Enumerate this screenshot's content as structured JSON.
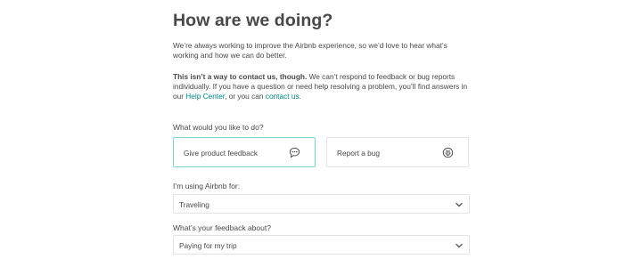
{
  "page": {
    "title": "How are we doing?",
    "intro": "We’re always working to improve the Airbnb experience, so we’d love to hear what’s working and how we can do better.",
    "notice_bold": "This isn’t a way to contact us, though.",
    "notice_text": " We can’t respond to feedback or bug reports individually. If you have a question or need help resolving a problem, you’ll find answers in our ",
    "help_center_link": "Help Center",
    "notice_mid": ", or you can ",
    "contact_link": "contact us",
    "notice_end": "."
  },
  "question": {
    "label": "What would you like to do?",
    "options": [
      {
        "label": "Give product feedback",
        "icon": "chat-bubble-icon",
        "selected": true
      },
      {
        "label": "Report a bug",
        "icon": "bug-icon",
        "selected": false
      }
    ]
  },
  "usage": {
    "label": "I’m using Airbnb for:",
    "value": "Traveling"
  },
  "topic": {
    "label": "What’s your feedback about?",
    "value": "Paying for my trip"
  },
  "colors": {
    "accent": "#008489",
    "selected_border": "#7fd3cf",
    "text": "#484848",
    "border": "#e4e4e4"
  }
}
